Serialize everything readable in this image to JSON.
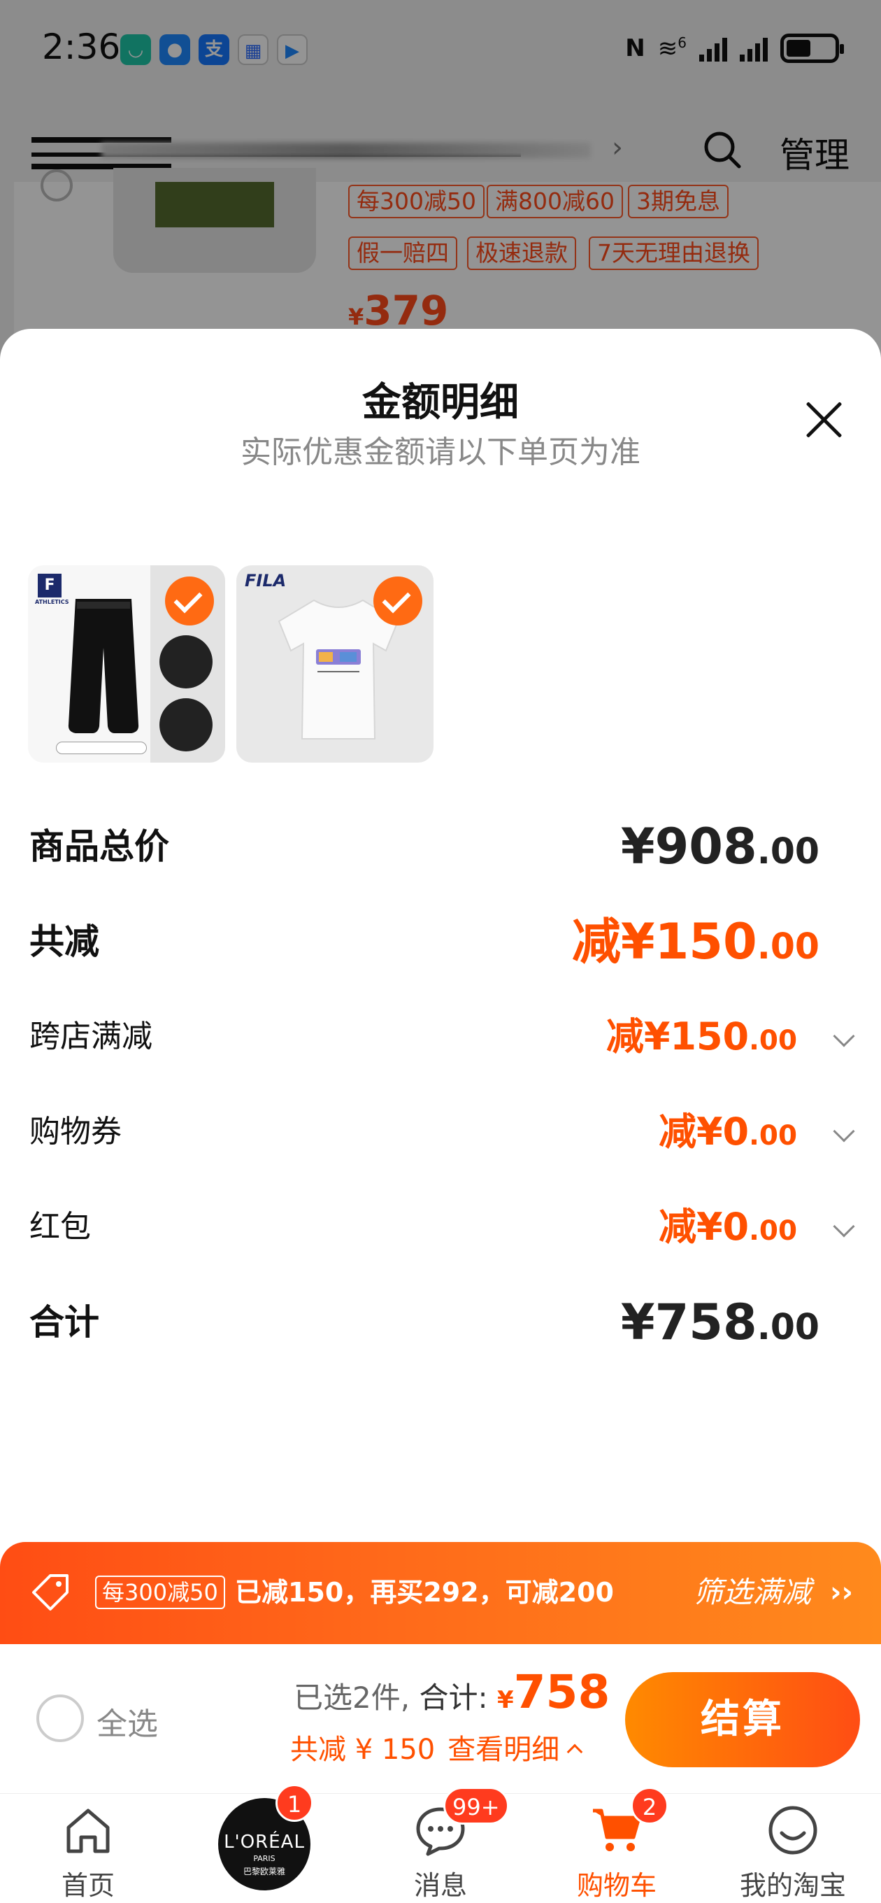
{
  "status_bar": {
    "time": "2:36",
    "net_label": "6"
  },
  "background_page": {
    "manage_label": "管理",
    "promo_tags": [
      "每300减50",
      "满800减60",
      "3期免息"
    ],
    "service_tags": [
      "假一赔四",
      "极速退款",
      "7天无理由退换"
    ],
    "price_symbol": "¥",
    "price": "379"
  },
  "sheet": {
    "title": "金额明细",
    "subtitle": "实际优惠金额请以下单页为准",
    "products": [
      {
        "name": "pants",
        "logo": "F",
        "logo_sub": "ATHLETICS",
        "selected": true
      },
      {
        "name": "tshirt",
        "brand_text": "FILA",
        "selected": true
      }
    ],
    "rows": {
      "total_price": {
        "label": "商品总价",
        "value": "¥908",
        "cents": ".00"
      },
      "total_reduce": {
        "label": "共减",
        "value": "减¥150",
        "cents": ".00"
      },
      "cross_store": {
        "label": "跨店满减",
        "value": "减¥150",
        "cents": ".00"
      },
      "coupon": {
        "label": "购物券",
        "value": "减¥0",
        "cents": ".00"
      },
      "red_packet": {
        "label": "红包",
        "value": "减¥0",
        "cents": ".00"
      },
      "sum": {
        "label": "合计",
        "value": "¥758",
        "cents": ".00"
      }
    }
  },
  "promo_banner": {
    "badge": "每300减50",
    "text": "已减150，再买292，可减200",
    "filter_label": "筛选满减",
    "chevron": "››"
  },
  "checkout": {
    "select_all": "全选",
    "selected_count": "已选2件,",
    "total_label": "合计:",
    "currency": "¥",
    "total_amount": "758",
    "reduce_text": "共减 ¥ 150",
    "detail_link": "查看明细",
    "pay_button": "结算"
  },
  "tabbar": {
    "tabs": [
      {
        "label": "首页",
        "icon": "home-icon"
      },
      {
        "label": "",
        "icon": "loreal-ad-icon",
        "badge": "1",
        "brand_lines": [
          "L'ORÉAL",
          "PARIS",
          "巴黎欧莱雅"
        ]
      },
      {
        "label": "消息",
        "icon": "message-icon",
        "badge": "99+"
      },
      {
        "label": "购物车",
        "icon": "cart-icon",
        "badge": "2",
        "active": true
      },
      {
        "label": "我的淘宝",
        "icon": "my-taobao-icon"
      }
    ]
  },
  "colors": {
    "accent": "#ff5000",
    "accent_gradient_start": "#ff8a00",
    "accent_gradient_end": "#ff4d14"
  }
}
